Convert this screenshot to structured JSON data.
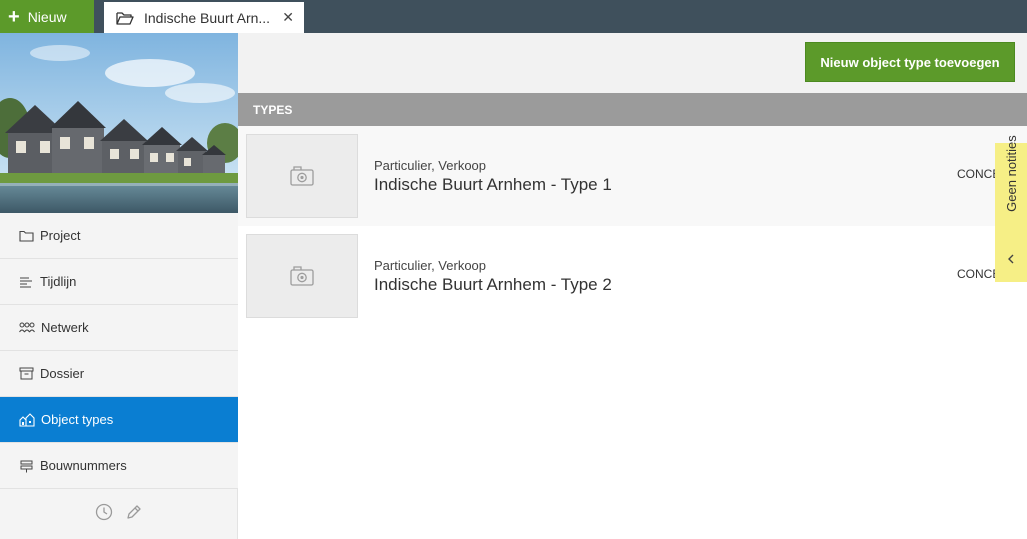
{
  "topbar": {
    "new_label": "Nieuw",
    "tab_title": "Indische Buurt Arn..."
  },
  "sidebar": {
    "items": [
      {
        "label": "Project",
        "icon": "folder-icon"
      },
      {
        "label": "Tijdlijn",
        "icon": "timeline-icon"
      },
      {
        "label": "Netwerk",
        "icon": "network-icon"
      },
      {
        "label": "Dossier",
        "icon": "archive-icon"
      },
      {
        "label": "Object types",
        "icon": "object-types-icon",
        "active": true
      },
      {
        "label": "Bouwnummers",
        "icon": "signpost-icon"
      }
    ],
    "tools": [
      "history-icon",
      "edit-icon"
    ]
  },
  "main": {
    "add_button_label": "Nieuw object type toevoegen",
    "section_title": "TYPES",
    "types": [
      {
        "subtitle": "Particulier, Verkoop",
        "title": "Indische Buurt Arnhem - Type 1",
        "status": "CONCEPT"
      },
      {
        "subtitle": "Particulier, Verkoop",
        "title": "Indische Buurt Arnhem - Type 2",
        "status": "CONCEPT"
      }
    ]
  },
  "notes": {
    "label": "Geen notities"
  },
  "colors": {
    "topbar": "#3f505c",
    "accent_green": "#5c9a2a",
    "active_blue": "#0a7ed2",
    "section_gray": "#9b9b9b",
    "notes_yellow": "#f6ef86"
  }
}
